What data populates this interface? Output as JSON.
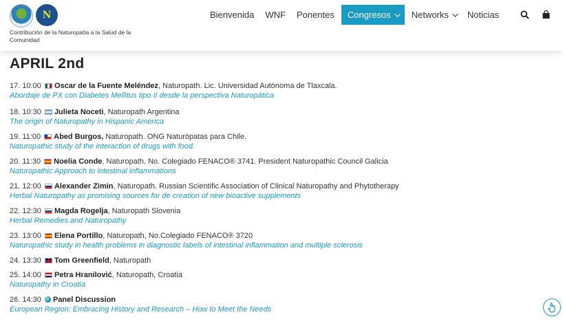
{
  "header": {
    "tagline": "Contribución de la Naturopatía a la Salud de la Comunidad",
    "logo_b_text": "N"
  },
  "nav": {
    "items": [
      {
        "label": "Bienvenida",
        "active": false,
        "dropdown": false
      },
      {
        "label": "WNF",
        "active": false,
        "dropdown": false
      },
      {
        "label": "Ponentes",
        "active": false,
        "dropdown": false
      },
      {
        "label": "Congresos",
        "active": true,
        "dropdown": true
      },
      {
        "label": "Networks",
        "active": false,
        "dropdown": true
      },
      {
        "label": "Noticias",
        "active": false,
        "dropdown": false
      }
    ],
    "search_icon": "search-icon",
    "cart_icon": "shopping-bag-icon"
  },
  "colors": {
    "accent": "#1a9bc4",
    "text": "#333333"
  },
  "schedule": {
    "date_title": "APRIL 2nd",
    "entries": [
      {
        "time": "17. 10:00",
        "flag": "mx",
        "name": "Oscar de la Fuente Meléndez",
        "detail": ", Naturopath. Lic. Universidad Autónoma de Tlaxcala.",
        "talk": "Abordaje de PX con Diabetes Mellitus tipo II desde la perspectiva Naturopática",
        "gap": true
      },
      {
        "time": "18. 10:30",
        "flag": "ar",
        "name": "Julieta Noceti",
        "detail": ", Naturopath Argentina",
        "talk": "The origin of Naturopathy in Hispanic America",
        "gap": false
      },
      {
        "time": "19. 11:00",
        "flag": "cl",
        "name": "Abed Burgos,",
        "detail": " Naturopath. ONG Naturópatas para Chile.",
        "talk": "Naturopathic study of the interaction of drugs with food.",
        "gap": false
      },
      {
        "time": "20. 11:30",
        "flag": "es",
        "name": "Noelia Conde",
        "detail": ", Naturopath. No. Colegiado FENACO® 3741. President Naturopathic Council Galicia",
        "talk": "Naturopathic Approach to intestinal inflammations",
        "gap": false
      },
      {
        "time": "21. 12:00",
        "flag": "ru",
        "name": "Alexander Zimin",
        "detail": ", Naturopath. Russian Scientific Association of Clinical Naturopathy and Phytotherapy",
        "talk": "Herbal Naturopathy as promising sources for de creation of new bioactive supplements",
        "gap": false
      },
      {
        "time": "22. 12:30",
        "flag": "si",
        "name": "Magda Rogelja",
        "detail": ", Naturopath Slovenia",
        "talk": "Herbal Remedies and Naturopathy",
        "gap": false
      },
      {
        "time": "23. 13:00",
        "flag": "es",
        "name": "Elena Portillo",
        "detail": ", Naturopath, No.Colegiado FENACO® 3720",
        "talk": "Naturopathic study in health problems in diagnostic labels of intestinal inflammation and multiple sclerosis",
        "gap": false
      },
      {
        "time": "24. 13:30",
        "flag": "gb",
        "name": "Tom Greenfield",
        "detail": ", Naturopath",
        "talk": "",
        "gap": false
      },
      {
        "time": "25. 14:00",
        "flag": "hr",
        "name": "Petra Hranilović",
        "detail": ", Naturopath, Croatia",
        "talk": "Naturopathy in Croatia",
        "gap": false
      },
      {
        "time": "26. 14:30",
        "flag": "globe",
        "name": "Panel Discussion",
        "detail": "",
        "talk": "European Region: Embracing History and Research – How to Meet the Needs",
        "gap": false
      }
    ]
  },
  "fab": {
    "icon": "hand-pointer-icon"
  }
}
